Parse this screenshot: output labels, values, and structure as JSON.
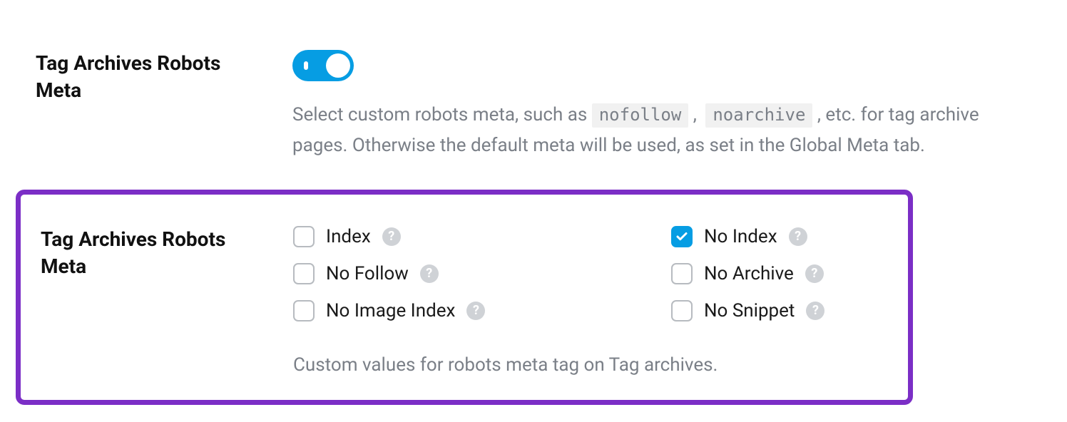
{
  "section1": {
    "label": "Tag Archives Robots Meta",
    "toggle_on": true,
    "desc_pre": "Select custom robots meta, such as ",
    "chip1": "nofollow",
    "desc_mid": " , ",
    "chip2": "noarchive",
    "desc_post": " , etc. for tag archive pages. Otherwise the default meta will be used, as set in the Global Meta tab."
  },
  "section2": {
    "label": "Tag Archives Robots Meta",
    "options": [
      {
        "label": "Index",
        "checked": false
      },
      {
        "label": "No Index",
        "checked": true
      },
      {
        "label": "No Follow",
        "checked": false
      },
      {
        "label": "No Archive",
        "checked": false
      },
      {
        "label": "No Image Index",
        "checked": false
      },
      {
        "label": "No Snippet",
        "checked": false
      }
    ],
    "footer": "Custom values for robots meta tag on Tag archives.",
    "help_glyph": "?"
  }
}
